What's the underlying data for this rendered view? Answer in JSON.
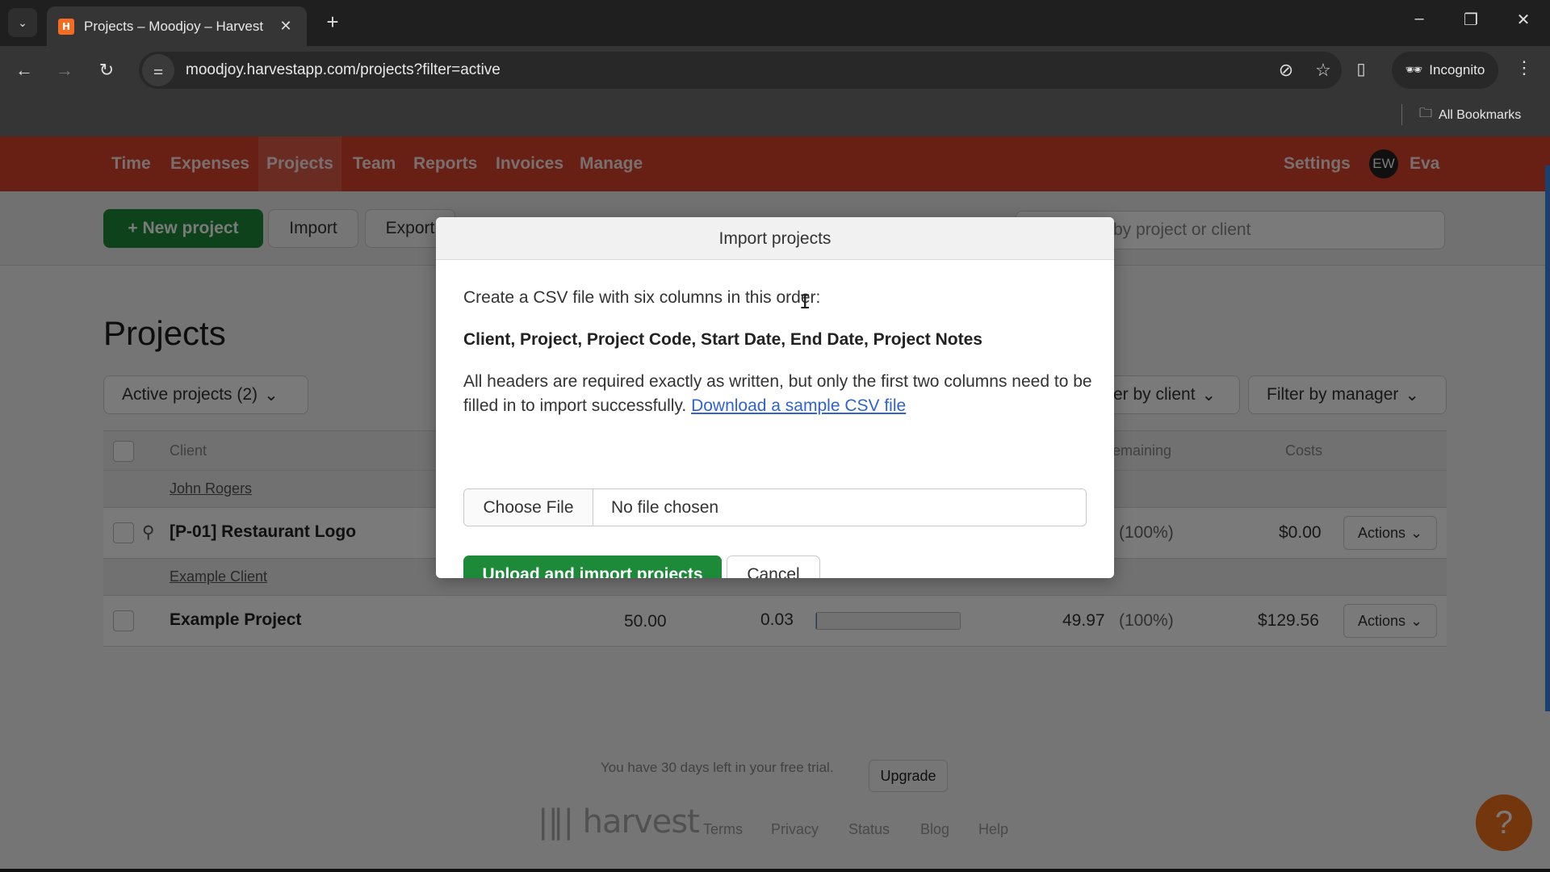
{
  "browser": {
    "tab_title": "Projects – Moodjoy – Harvest",
    "tab_favicon": "H",
    "url": "moodjoy.harvestapp.com/projects?filter=active",
    "incognito_label": "Incognito",
    "bookmarks_label": "All Bookmarks",
    "icons": {
      "tab_list": "⌄",
      "close": "✕",
      "new_tab": "+",
      "minimize": "–",
      "restore": "❐",
      "window_close": "✕",
      "back": "←",
      "forward": "→",
      "reload": "↻",
      "site_info": "⚌",
      "eye_off": "⊘",
      "star": "☆",
      "side_panel": "▯",
      "menu": "⋮",
      "folder": "🗀",
      "incognito": "🕶"
    }
  },
  "nav": {
    "items": [
      {
        "label": "Time"
      },
      {
        "label": "Expenses"
      },
      {
        "label": "Projects",
        "active": true
      },
      {
        "label": "Team"
      },
      {
        "label": "Reports"
      },
      {
        "label": "Invoices"
      },
      {
        "label": "Manage"
      }
    ],
    "settings": "Settings",
    "user_initials": "EW",
    "user_name": "Eva"
  },
  "actionbar": {
    "new_project": "+ New project",
    "import": "Import",
    "export": "Export",
    "search_placeholder": "Filter by project or client",
    "search_visible": "by project or client"
  },
  "main": {
    "title": "Projects",
    "active_filter": "Active projects (2)",
    "filter_client": "Filter by client",
    "filter_client_visible": "er by client",
    "filter_manager": "Filter by manager",
    "columns": {
      "client": "Client",
      "remaining": "Remaining",
      "remaining_visible": "emaining",
      "costs": "Costs"
    },
    "groups": [
      {
        "client": "John Rogers",
        "projects": [
          {
            "name": "[P-01] Restaurant Logo",
            "pinned": true,
            "remaining_pct": "(100%)",
            "costs": "$0.00",
            "actions": "Actions"
          }
        ]
      },
      {
        "client": "Example Client",
        "projects": [
          {
            "name": "Example Project",
            "budget": "50.00",
            "spent": "0.03",
            "progress": 0.0006,
            "remaining": "49.97",
            "remaining_pct": "(100%)",
            "costs": "$129.56",
            "actions": "Actions"
          }
        ]
      }
    ]
  },
  "footer": {
    "trial_text": "You have 30 days left in your free trial.",
    "upgrade": "Upgrade",
    "logo": "harvest",
    "links": [
      "Terms",
      "Privacy",
      "Status",
      "Blog",
      "Help"
    ],
    "help_icon": "?"
  },
  "modal": {
    "title": "Import projects",
    "intro": "Create a CSV file with six columns in this order:",
    "columns_list": "Client, Project, Project Code, Start Date, End Date, Project Notes",
    "requirement_text": "All headers are required exactly as written, but only the first two columns need to be filled in to import successfully.",
    "sample_link": "Download a sample CSV file",
    "choose_file": "Choose File",
    "file_status": "No file chosen",
    "upload_button": "Upload and import projects",
    "cancel_button": "Cancel"
  },
  "colors": {
    "nav_red": "#d9412b",
    "primary_green": "#1d8a3a",
    "link_blue": "#2f63d0",
    "help_orange": "#f0711d"
  }
}
